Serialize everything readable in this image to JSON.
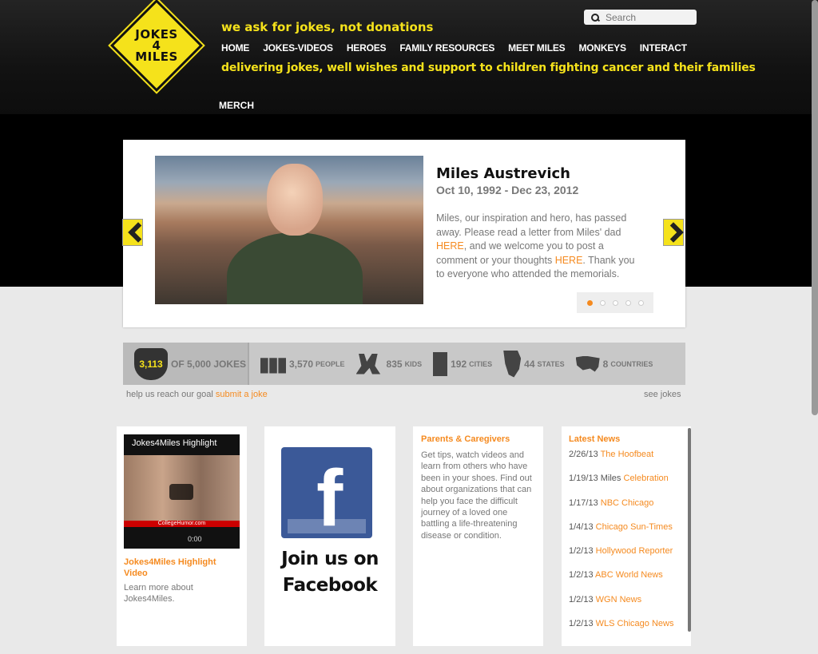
{
  "header": {
    "logo_lines": [
      "JOKES",
      "4",
      "MILES"
    ],
    "tagline": "we ask for jokes, not donations",
    "nav": [
      "HOME",
      "JOKES-VIDEOS",
      "HEROES",
      "FAMILY RESOURCES",
      "MEET MILES",
      "MONKEYS",
      "INTERACT"
    ],
    "merch": "MERCH",
    "subtagline": "delivering jokes, well wishes and support to children fighting cancer and their families",
    "search_placeholder": "Search"
  },
  "slider": {
    "name": "Miles Austrevich",
    "dates": "Oct 10, 1992 - Dec 23, 2012",
    "text1": "Miles, our inspiration and hero, has passed away.  Please read a letter from Miles' dad ",
    "link1": "HERE",
    "text2": ", and we welcome you to post a comment or your thoughts ",
    "link2": "HERE",
    "text3": ".  Thank you to everyone who attended the memorials.",
    "dots": 5,
    "active_dot": 0
  },
  "stats": {
    "jokes_count": "3,113",
    "jokes_goal": "OF 5,000 JOKES",
    "people_num": "3,570",
    "people_label": "PEOPLE",
    "kids_num": "835",
    "kids_label": "KIDS",
    "cities_num": "192",
    "cities_label": "CITIES",
    "states_num": "44",
    "states_label": "STATES",
    "countries_num": "8",
    "countries_label": "COUNTRIES",
    "reach_text": "help us reach our goal ",
    "submit_link": "submit a joke",
    "see_jokes": "see jokes"
  },
  "video_card": {
    "video_title": "Jokes4Miles Highlight",
    "channel": "CollegeHumor.com",
    "time": "0:00",
    "title": "Jokes4Miles Highlight Video",
    "desc": "Learn more about Jokes4Miles."
  },
  "facebook_card": {
    "f": "f",
    "text": "Join us on Facebook"
  },
  "parents_card": {
    "title": "Parents & Caregivers",
    "desc": "Get tips, watch videos and learn from others who have been in your shoes.  Find out about organizations that can help you face the difficult journey of a loved one battling a life-threatening disease or condition."
  },
  "news_card": {
    "title": "Latest News",
    "items": [
      {
        "date": "2/26/13",
        "src": "The Hoofbeat"
      },
      {
        "date": "1/19/13 Miles",
        "src": "Celebration"
      },
      {
        "date": "1/17/13",
        "src": "NBC Chicago"
      },
      {
        "date": "1/4/13",
        "src": "Chicago Sun-Times"
      },
      {
        "date": "1/2/13",
        "src": "Hollywood Reporter"
      },
      {
        "date": "1/2/13",
        "src": "ABC World News"
      },
      {
        "date": "1/2/13",
        "src": "WGN News"
      },
      {
        "date": "1/2/13",
        "src": "WLS Chicago News"
      }
    ]
  },
  "colors": {
    "brand_yellow": "#f5e21b",
    "link_orange": "#f58a1f",
    "facebook_blue": "#3b5998"
  }
}
